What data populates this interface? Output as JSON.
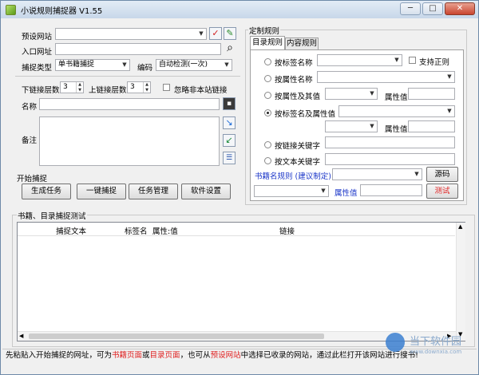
{
  "window": {
    "title": "小说规则捕捉器 V1.55",
    "min": "─",
    "max": "□",
    "close": "✕"
  },
  "left": {
    "preset_site_label": "预设网站",
    "entry_url_label": "入口网址",
    "capture_type_label": "捕捉类型",
    "capture_type_value": "单书籍捕捉",
    "encoding_label": "编码",
    "encoding_value": "自动检测(一次)",
    "down_link_label": "下链接层数",
    "down_link_value": "3",
    "up_link_label": "上链接层数",
    "up_link_value": "3",
    "ignore_offsite_label": "忽略非本站链接",
    "name_label": "名称",
    "note_label": "备注",
    "start_group_label": "开始捕捉",
    "buttons": [
      "生成任务",
      "一键捕捉",
      "任务管理",
      "软件设置"
    ]
  },
  "rules": {
    "group_label": "定制规则",
    "tabs": [
      "目录规则",
      "内容规则"
    ],
    "tag_name_label": "按标签名称",
    "support_regex_label": "支持正则",
    "attr_name_label": "按属性名称",
    "attr_and_value_label": "按属性及其值",
    "attr_value_label": "属性值",
    "tag_and_attr_label": "按标签名及属性值",
    "attr_value_label_2": "属性值",
    "link_keyword_label": "按链接关键字",
    "text_keyword_label": "按文本关键字",
    "book_rule_label": "书籍名规则 (建议制定)",
    "source_button": "源码",
    "attr_value_label_3": "属性值",
    "test_button": "测试"
  },
  "test_area": {
    "group_label": "书籍、目录捕捉测试",
    "columns": [
      "捕捉文本",
      "标签名",
      "属性:值",
      "链接"
    ]
  },
  "status": {
    "segments": [
      {
        "text": "先粘贴入开始捕捉的网址，可为",
        "color": "#000000"
      },
      {
        "text": "书籍页面",
        "color": "#e02020"
      },
      {
        "text": "或",
        "color": "#000000"
      },
      {
        "text": "目录页面",
        "color": "#e02020"
      },
      {
        "text": "，也可从",
        "color": "#000000"
      },
      {
        "text": "预设网站",
        "color": "#e02020"
      },
      {
        "text": "中选择已收录的网站，通过此栏打开该网站进行搜书!",
        "color": "#000000"
      }
    ]
  },
  "watermark": {
    "text": "当下软件园",
    "subtext": "www.downxia.com"
  }
}
